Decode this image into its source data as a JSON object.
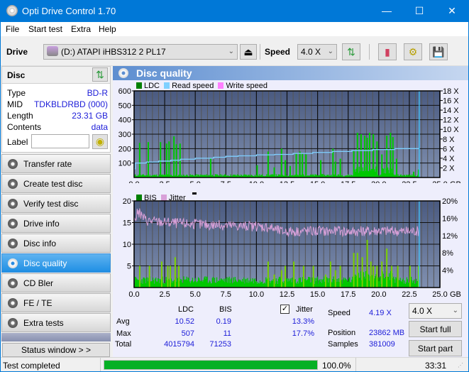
{
  "window": {
    "title": "Opti Drive Control 1.70",
    "minimize": "—",
    "maximize": "☐",
    "close": "✕"
  },
  "menu": [
    "File",
    "Start test",
    "Extra",
    "Help"
  ],
  "toolbar": {
    "drive_label": "Drive",
    "drive_value": "(D:)  ATAPI iHBS312  2 PL17",
    "speed_label": "Speed",
    "speed_value": "4.0 X"
  },
  "disc": {
    "header": "Disc",
    "rows": [
      {
        "key": "Type",
        "value": "BD-R"
      },
      {
        "key": "MID",
        "value": "TDKBLDRBD (000)"
      },
      {
        "key": "Length",
        "value": "23.31 GB"
      },
      {
        "key": "Contents",
        "value": "data"
      }
    ],
    "label_key": "Label",
    "label_value": ""
  },
  "nav": [
    {
      "label": "Transfer rate",
      "active": false
    },
    {
      "label": "Create test disc",
      "active": false
    },
    {
      "label": "Verify test disc",
      "active": false
    },
    {
      "label": "Drive info",
      "active": false
    },
    {
      "label": "Disc info",
      "active": false
    },
    {
      "label": "Disc quality",
      "active": true
    },
    {
      "label": "CD Bler",
      "active": false
    },
    {
      "label": "FE / TE",
      "active": false
    },
    {
      "label": "Extra tests",
      "active": false
    }
  ],
  "status_window_button": "Status window > >",
  "panel_title": "Disc quality",
  "colors": {
    "ldc": "#00c800",
    "read_speed": "#7fd0ff",
    "write_speed": "#ff80ff",
    "bis": "#00c800",
    "jitter": "#d8a0d8",
    "plot_bg_top": "#4a5a80",
    "plot_bg_bottom": "#8090b0",
    "accent": "#0078d7"
  },
  "chart_data": [
    {
      "type": "bar",
      "title": "LDC / Read speed",
      "legend": [
        "LDC",
        "Read speed",
        "Write speed"
      ],
      "legend_position": "top-left",
      "xlabel": "GB",
      "x_ticks": [
        "0.0",
        "2.5",
        "5.0",
        "7.5",
        "10.0",
        "12.5",
        "15.0",
        "17.5",
        "20.0",
        "22.5",
        "25.0"
      ],
      "xlim": [
        0,
        25
      ],
      "y_left_ticks": [
        "100",
        "200",
        "300",
        "400",
        "500",
        "600"
      ],
      "ylim_left": [
        0,
        600
      ],
      "y_right_ticks": [
        "2 X",
        "4 X",
        "6 X",
        "8 X",
        "10 X",
        "12 X",
        "14 X",
        "16 X",
        "18 X"
      ],
      "ylim_right": [
        0,
        18
      ],
      "grid": true,
      "series": [
        {
          "name": "LDC",
          "spikes_x": [
            0.4,
            1.1,
            2.1,
            2.6,
            2.8,
            3.2,
            3.4,
            3.7,
            6.2,
            10.0,
            10.9,
            11.4,
            12.0,
            12.3,
            12.7,
            13.2,
            13.5,
            13.7,
            14.0,
            15.2,
            16.2,
            16.4,
            16.8,
            17.9,
            18.2,
            18.5,
            18.8,
            19.0,
            19.2,
            19.5,
            19.8,
            20.2,
            20.6,
            20.9,
            21.1,
            21.4,
            22.8,
            23.2
          ],
          "spikes_y": [
            240,
            245,
            245,
            235,
            250,
            285,
            230,
            235,
            130,
            85,
            180,
            70,
            200,
            120,
            80,
            170,
            180,
            170,
            160,
            120,
            200,
            110,
            130,
            190,
            310,
            300,
            290,
            275,
            310,
            300,
            250,
            160,
            290,
            310,
            280,
            130,
            40,
            55
          ],
          "baseline": 18
        },
        {
          "name": "Read speed",
          "x": [
            0.0,
            0.1,
            1.0,
            2.0,
            3.0,
            3.8,
            5.0,
            6.5,
            7.5,
            8.5,
            10.0,
            11.5,
            13.0,
            14.6,
            16.2,
            17.8,
            19.5,
            21.3,
            23.3
          ],
          "y": [
            1.8,
            3.0,
            3.2,
            3.4,
            3.6,
            3.8,
            4.0,
            4.2,
            4.4,
            4.5,
            4.7,
            4.8,
            5.0,
            5.2,
            5.4,
            5.6,
            5.8,
            6.0,
            6.2
          ]
        }
      ],
      "end_marker_x": 23.31
    },
    {
      "type": "bar",
      "title": "BIS / Jitter",
      "legend": [
        "BIS",
        "Jitter"
      ],
      "legend_position": "top-left",
      "xlabel": "GB",
      "x_ticks": [
        "0.0",
        "2.5",
        "5.0",
        "7.5",
        "10.0",
        "12.5",
        "15.0",
        "17.5",
        "20.0",
        "22.5",
        "25.0"
      ],
      "xlim": [
        0,
        25
      ],
      "y_left_ticks": [
        "5",
        "10",
        "15",
        "20"
      ],
      "ylim_left": [
        0,
        20
      ],
      "y_right_ticks": [
        "4%",
        "8%",
        "12%",
        "16%",
        "20%"
      ],
      "ylim_right": [
        0,
        20
      ],
      "grid": true,
      "series": [
        {
          "name": "BIS",
          "spikes_x": [
            0.4,
            1.2,
            2.2,
            2.7,
            2.9,
            3.3,
            3.6,
            10.9,
            11.4,
            12.0,
            12.3,
            13.0,
            13.8,
            14.6,
            15.6,
            16.0,
            16.4,
            16.8,
            17.9,
            18.2,
            18.6,
            19.0,
            19.3,
            19.5,
            19.8,
            20.2,
            20.6,
            21.0,
            21.5,
            22.5,
            23.2
          ],
          "spikes_y": [
            5,
            5,
            6,
            5,
            5,
            7,
            5,
            6,
            3,
            4,
            5,
            6,
            5,
            5,
            3,
            6,
            4,
            5,
            8,
            8,
            7,
            11,
            6,
            5,
            5,
            6,
            9,
            5,
            5,
            5,
            5
          ],
          "baseline": 2
        },
        {
          "name": "Jitter",
          "x": [
            0,
            0.3,
            1,
            2,
            3,
            4,
            5,
            6,
            7,
            8,
            9,
            10,
            11,
            12,
            13,
            14,
            15,
            16,
            17,
            18,
            19,
            20,
            21,
            22,
            23.3
          ],
          "y": [
            15.0,
            17.5,
            15.5,
            15.2,
            15.0,
            14.8,
            14.6,
            14.5,
            14.4,
            14.3,
            14.2,
            14.1,
            14.0,
            13.0,
            13.0,
            13.1,
            13.0,
            13.0,
            13.0,
            12.9,
            13.0,
            13.1,
            13.0,
            12.9,
            13.0
          ]
        }
      ],
      "end_marker_x": 23.31
    }
  ],
  "stats": {
    "col_ldc": "LDC",
    "col_bis": "BIS",
    "jitter_label": "Jitter",
    "jitter_checked": true,
    "rows": [
      {
        "label": "Avg",
        "ldc": "10.52",
        "bis": "0.19",
        "jitter": "13.3%"
      },
      {
        "label": "Max",
        "ldc": "507",
        "bis": "11",
        "jitter": "17.7%"
      },
      {
        "label": "Total",
        "ldc": "4015794",
        "bis": "71253",
        "jitter": ""
      }
    ],
    "speed_label": "Speed",
    "speed_value": "4.19 X",
    "position_label": "Position",
    "position_value": "23862 MB",
    "samples_label": "Samples",
    "samples_value": "381009",
    "speed_select": "4.0 X",
    "start_full": "Start full",
    "start_part": "Start part"
  },
  "status": {
    "text": "Test completed",
    "progress": 100.0,
    "progress_text": "100.0%",
    "time": "33:31"
  }
}
